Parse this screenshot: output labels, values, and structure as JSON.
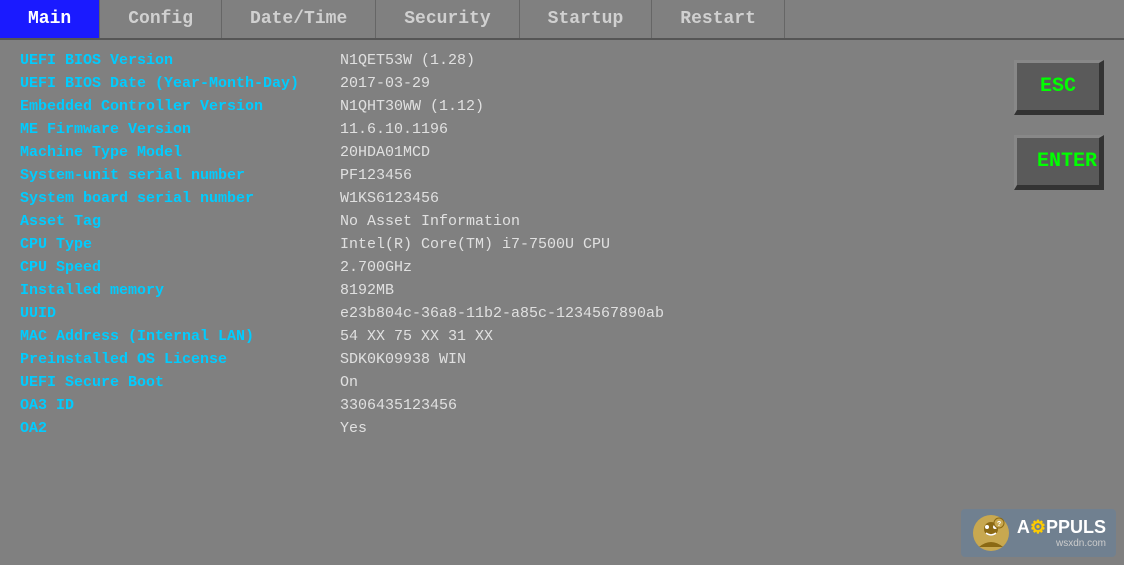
{
  "nav": {
    "items": [
      {
        "label": "Main",
        "active": true
      },
      {
        "label": "Config",
        "active": false
      },
      {
        "label": "Date/Time",
        "active": false
      },
      {
        "label": "Security",
        "active": false
      },
      {
        "label": "Startup",
        "active": false
      },
      {
        "label": "Restart",
        "active": false
      }
    ]
  },
  "info_rows": [
    {
      "label": "UEFI BIOS Version",
      "value": "N1QET53W (1.28)"
    },
    {
      "label": "UEFI BIOS Date (Year-Month-Day)",
      "value": "2017-03-29"
    },
    {
      "label": "Embedded Controller Version",
      "value": "N1QHT30WW (1.12)"
    },
    {
      "label": "ME Firmware Version",
      "value": "11.6.10.1196"
    },
    {
      "label": "Machine Type Model",
      "value": "20HDA01MCD"
    },
    {
      "label": "System-unit serial number",
      "value": "PF123456"
    },
    {
      "label": "System board serial number",
      "value": "W1KS6123456"
    },
    {
      "label": "Asset Tag",
      "value": "No Asset Information"
    },
    {
      "label": "CPU Type",
      "value": "Intel(R) Core(TM) i7-7500U CPU"
    },
    {
      "label": "CPU Speed",
      "value": "2.700GHz"
    },
    {
      "label": "Installed memory",
      "value": "8192MB"
    },
    {
      "label": "UUID",
      "value": "e23b804c-36a8-11b2-a85c-1234567890ab"
    },
    {
      "label": "MAC Address (Internal LAN)",
      "value": "54 XX 75 XX 31 XX"
    },
    {
      "label": "Preinstalled OS License",
      "value": "SDK0K09938 WIN"
    },
    {
      "label": "UEFI Secure Boot",
      "value": "On"
    },
    {
      "label": "OA3 ID",
      "value": "3306435123456"
    },
    {
      "label": "OA2",
      "value": "Yes"
    }
  ],
  "buttons": {
    "esc_label": "ESC",
    "enter_label": "ENTER"
  },
  "logo": {
    "text": "A PPULS",
    "sub": "wsxdn.com"
  }
}
